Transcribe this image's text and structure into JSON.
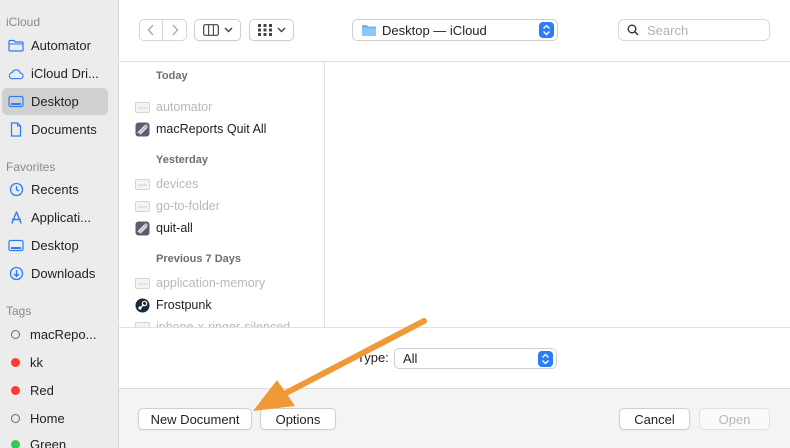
{
  "sidebar": {
    "sections": [
      {
        "heading": "iCloud",
        "items": [
          {
            "label": "Automator",
            "icon": "folder-icon",
            "selected": false
          },
          {
            "label": "iCloud Dri...",
            "icon": "cloud-icon",
            "selected": false
          },
          {
            "label": "Desktop",
            "icon": "desktop-icon",
            "selected": true
          },
          {
            "label": "Documents",
            "icon": "document-icon",
            "selected": false
          }
        ]
      },
      {
        "heading": "Favorites",
        "items": [
          {
            "label": "Recents",
            "icon": "clock-icon"
          },
          {
            "label": "Applicati...",
            "icon": "applications-icon"
          },
          {
            "label": "Desktop",
            "icon": "desktop-icon"
          },
          {
            "label": "Downloads",
            "icon": "download-icon"
          }
        ]
      },
      {
        "heading": "Tags",
        "items": [
          {
            "label": "macRepo...",
            "color": "#ffffff"
          },
          {
            "label": "kk",
            "color": "#ff3b30"
          },
          {
            "label": "Red",
            "color": "#ff3b30"
          },
          {
            "label": "Home",
            "color": "#ffffff"
          },
          {
            "label": "Green",
            "color": "#34c759"
          }
        ]
      }
    ]
  },
  "toolbar": {
    "location": "Desktop — iCloud",
    "search_placeholder": "Search"
  },
  "file_list": {
    "groups": [
      {
        "title": "Today",
        "items": [
          {
            "name": "automator",
            "enabled": false,
            "icon": "file-icon"
          },
          {
            "name": "macReports Quit All",
            "enabled": true,
            "icon": "automator-app-icon"
          }
        ]
      },
      {
        "title": "Yesterday",
        "items": [
          {
            "name": "devices",
            "enabled": false,
            "icon": "file-icon"
          },
          {
            "name": "go-to-folder",
            "enabled": false,
            "icon": "file-icon"
          },
          {
            "name": "quit-all",
            "enabled": true,
            "icon": "automator-app-icon"
          }
        ]
      },
      {
        "title": "Previous 7 Days",
        "items": [
          {
            "name": "application-memory",
            "enabled": false,
            "icon": "file-icon"
          },
          {
            "name": "Frostpunk",
            "enabled": true,
            "icon": "steam-icon"
          },
          {
            "name": "iphone-x-ringer-silenced",
            "enabled": false,
            "icon": "file-icon"
          }
        ]
      }
    ]
  },
  "format": {
    "label": "Type:",
    "value": "All"
  },
  "footer": {
    "new_document": "New Document",
    "options": "Options",
    "cancel": "Cancel",
    "open": "Open"
  },
  "colors": {
    "accent": "#2b7cf6",
    "annotation_arrow": "#f09a37"
  }
}
